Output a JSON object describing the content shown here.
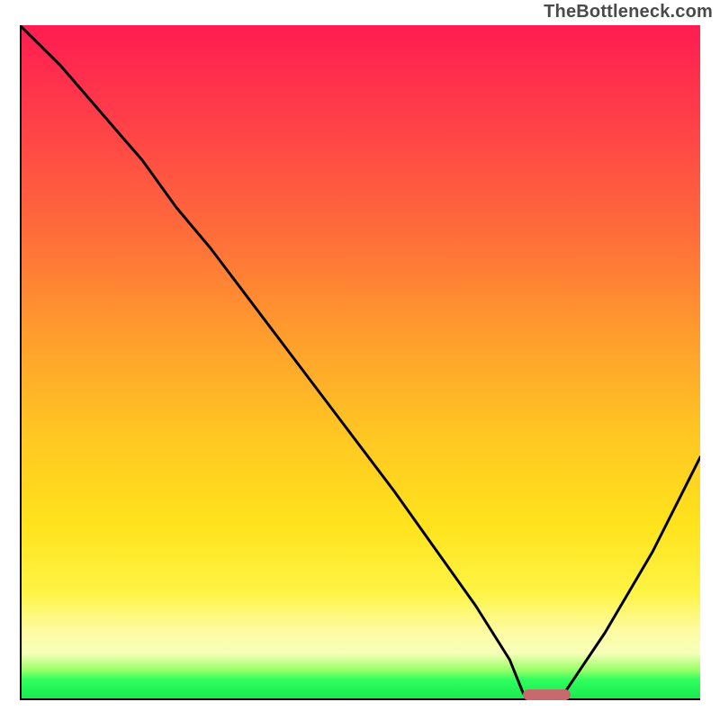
{
  "watermark": "TheBottleneck.com",
  "colors": {
    "gradient_top": "#ff1c51",
    "gradient_mid": "#ffe31c",
    "gradient_bottom": "#17e84e",
    "curve": "#000000",
    "axis": "#000000",
    "marker": "#c76a6e"
  },
  "chart_data": {
    "type": "line",
    "title": "",
    "xlabel": "",
    "ylabel": "",
    "xlim": [
      0,
      100
    ],
    "ylim": [
      0,
      100
    ],
    "grid": false,
    "legend": false,
    "note": "Axes are unlabeled in the source image; x/y are normalized 0–100. The curve is a V-shape: steep descent from upper-left, short flat valley around x≈74–80 at the baseline, then a rise toward the right edge.",
    "series": [
      {
        "name": "curve",
        "x": [
          0,
          6,
          12,
          18,
          23,
          28,
          40,
          55,
          67,
          72,
          74,
          80,
          86,
          93,
          100
        ],
        "y": [
          100,
          94,
          87,
          80,
          73,
          67,
          51,
          31,
          14,
          6,
          1,
          1,
          10,
          22,
          36
        ]
      }
    ],
    "annotations": [
      {
        "name": "optimum-marker",
        "shape": "pill",
        "x_start": 74,
        "x_end": 81,
        "y": 0.5,
        "color": "#c76a6e"
      }
    ]
  }
}
